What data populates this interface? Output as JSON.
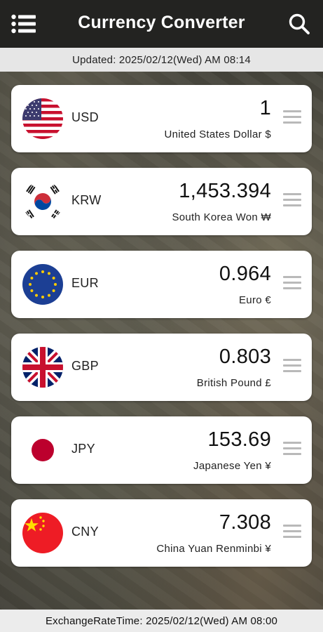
{
  "app": {
    "title": "Currency Converter",
    "menu_icon": "menu-list-icon",
    "search_icon": "search-icon"
  },
  "updated": "Updated: 2025/02/12(Wed) AM 08:14",
  "exchange_rate_time": "ExchangeRateTime: 2025/02/12(Wed) AM 08:00",
  "currencies": [
    {
      "code": "USD",
      "amount": "1",
      "name": "United States Dollar $",
      "flag": "us-flag"
    },
    {
      "code": "KRW",
      "amount": "1,453.394",
      "name": "South Korea Won ₩",
      "flag": "kr-flag"
    },
    {
      "code": "EUR",
      "amount": "0.964",
      "name": "Euro €",
      "flag": "eu-flag"
    },
    {
      "code": "GBP",
      "amount": "0.803",
      "name": "British Pound £",
      "flag": "gb-flag"
    },
    {
      "code": "JPY",
      "amount": "153.69",
      "name": "Japanese Yen ¥",
      "flag": "jp-flag"
    },
    {
      "code": "CNY",
      "amount": "7.308",
      "name": "China Yuan Renminbi ¥",
      "flag": "cn-flag"
    }
  ],
  "colors": {
    "appbar": "#232321",
    "card": "#ffffff",
    "handle": "#b9b9b9"
  }
}
